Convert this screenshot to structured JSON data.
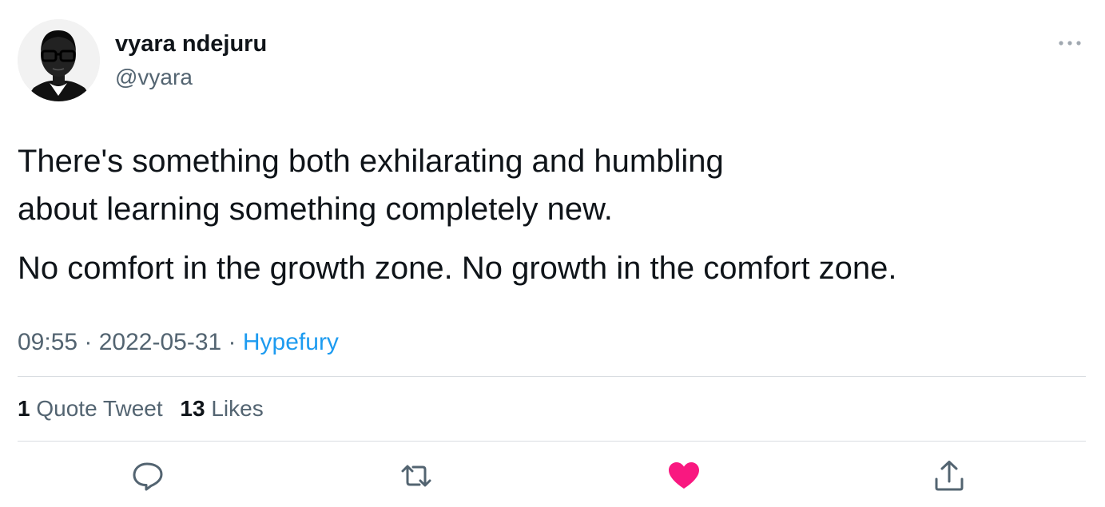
{
  "author": {
    "name": "vyara ndejuru",
    "handle": "@vyara",
    "avatar_icon": "profile-photo"
  },
  "more_icon": "more-horizontal-icon",
  "tweet": {
    "paragraphs": [
      "There's something both exhilarating and humbling\nabout learning something completely new.",
      "No comfort in the growth zone. No growth in the comfort zone."
    ]
  },
  "meta": {
    "time": "09:55",
    "separator": " · ",
    "date": "2022-05-31",
    "source": "Hypefury"
  },
  "stats": {
    "quote_count": "1",
    "quote_label": "Quote Tweet",
    "like_count": "13",
    "like_label": "Likes"
  },
  "actions": [
    {
      "icon": "reply-icon"
    },
    {
      "icon": "retweet-icon"
    },
    {
      "icon": "like-icon",
      "color": "#f91880",
      "liked": true
    },
    {
      "icon": "share-icon"
    }
  ],
  "colors": {
    "text_primary": "#0f1419",
    "text_secondary": "#536471",
    "link": "#1d9bf0",
    "like": "#f91880",
    "divider": "#d9dde1"
  }
}
